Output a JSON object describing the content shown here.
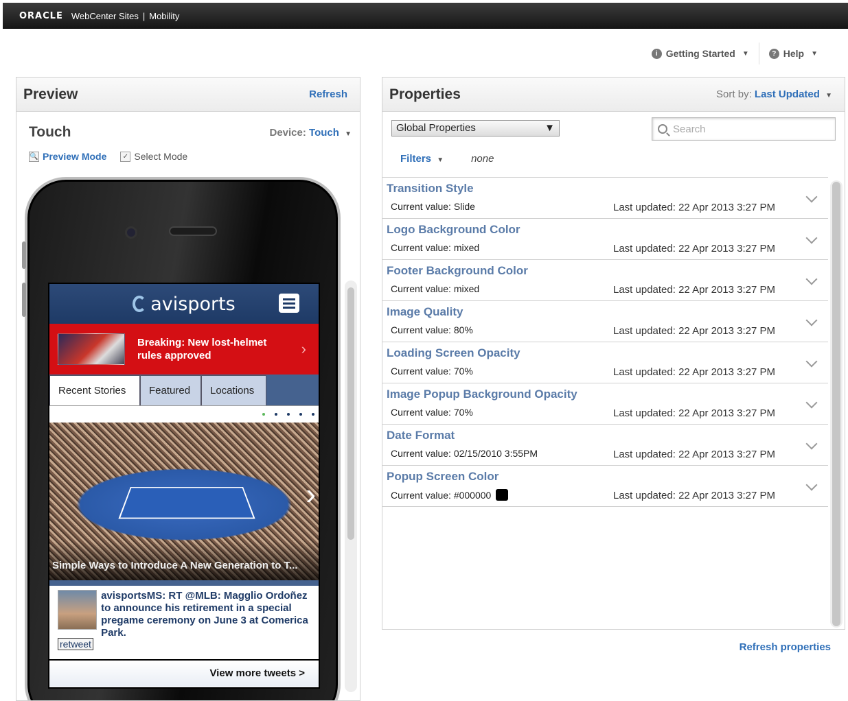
{
  "topbar": {
    "brand": "ORACLE",
    "product": "WebCenter Sites",
    "separator": "|",
    "module": "Mobility"
  },
  "help": {
    "getting_started": "Getting Started",
    "help": "Help"
  },
  "preview": {
    "title": "Preview",
    "refresh": "Refresh",
    "device_title": "Touch",
    "device_label": "Device:",
    "device_value": "Touch",
    "preview_mode": "Preview Mode",
    "select_mode": "Select Mode",
    "screen": {
      "logo": "avisports",
      "breaking": "Breaking: New lost-helmet rules approved",
      "tabs": [
        "Recent Stories",
        "Featured",
        "Locations"
      ],
      "hero_caption": "Simple Ways to Introduce A New Generation to T...",
      "tweet": "avisportsMS: RT @MLB: Magglio Ordoñez to announce his retirement in a special pregame ceremony on June 3 at Comerica Park.",
      "retweet": "retweet",
      "more": "View more tweets >"
    }
  },
  "properties": {
    "title": "Properties",
    "sort_label": "Sort by:",
    "sort_value": "Last Updated",
    "scope": "Global Properties",
    "search_placeholder": "Search",
    "filters_label": "Filters",
    "filters_value": "none",
    "items": [
      {
        "name": "Transition Style",
        "current": "Current value: Slide",
        "updated": "Last updated: 22 Apr 2013 3:27 PM"
      },
      {
        "name": "Logo Background Color",
        "current": "Current value: mixed",
        "updated": "Last updated: 22 Apr 2013 3:27 PM"
      },
      {
        "name": "Footer Background Color",
        "current": "Current value: mixed",
        "updated": "Last updated: 22 Apr 2013 3:27 PM"
      },
      {
        "name": "Image Quality",
        "current": "Current value: 80%",
        "updated": "Last updated: 22 Apr 2013 3:27 PM"
      },
      {
        "name": "Loading Screen Opacity",
        "current": "Current value: 70%",
        "updated": "Last updated: 22 Apr 2013 3:27 PM"
      },
      {
        "name": "Image Popup Background Opacity",
        "current": "Current value: 70%",
        "updated": "Last updated: 22 Apr 2013 3:27 PM"
      },
      {
        "name": "Date Format",
        "current": "Current value: 02/15/2010 3:55PM",
        "updated": "Last updated: 22 Apr 2013 3:27 PM"
      },
      {
        "name": "Popup Screen Color",
        "current": "Current value: #000000",
        "updated": "Last updated: 22 Apr 2013 3:27 PM",
        "swatch": "#000000"
      }
    ],
    "refresh": "Refresh properties"
  }
}
